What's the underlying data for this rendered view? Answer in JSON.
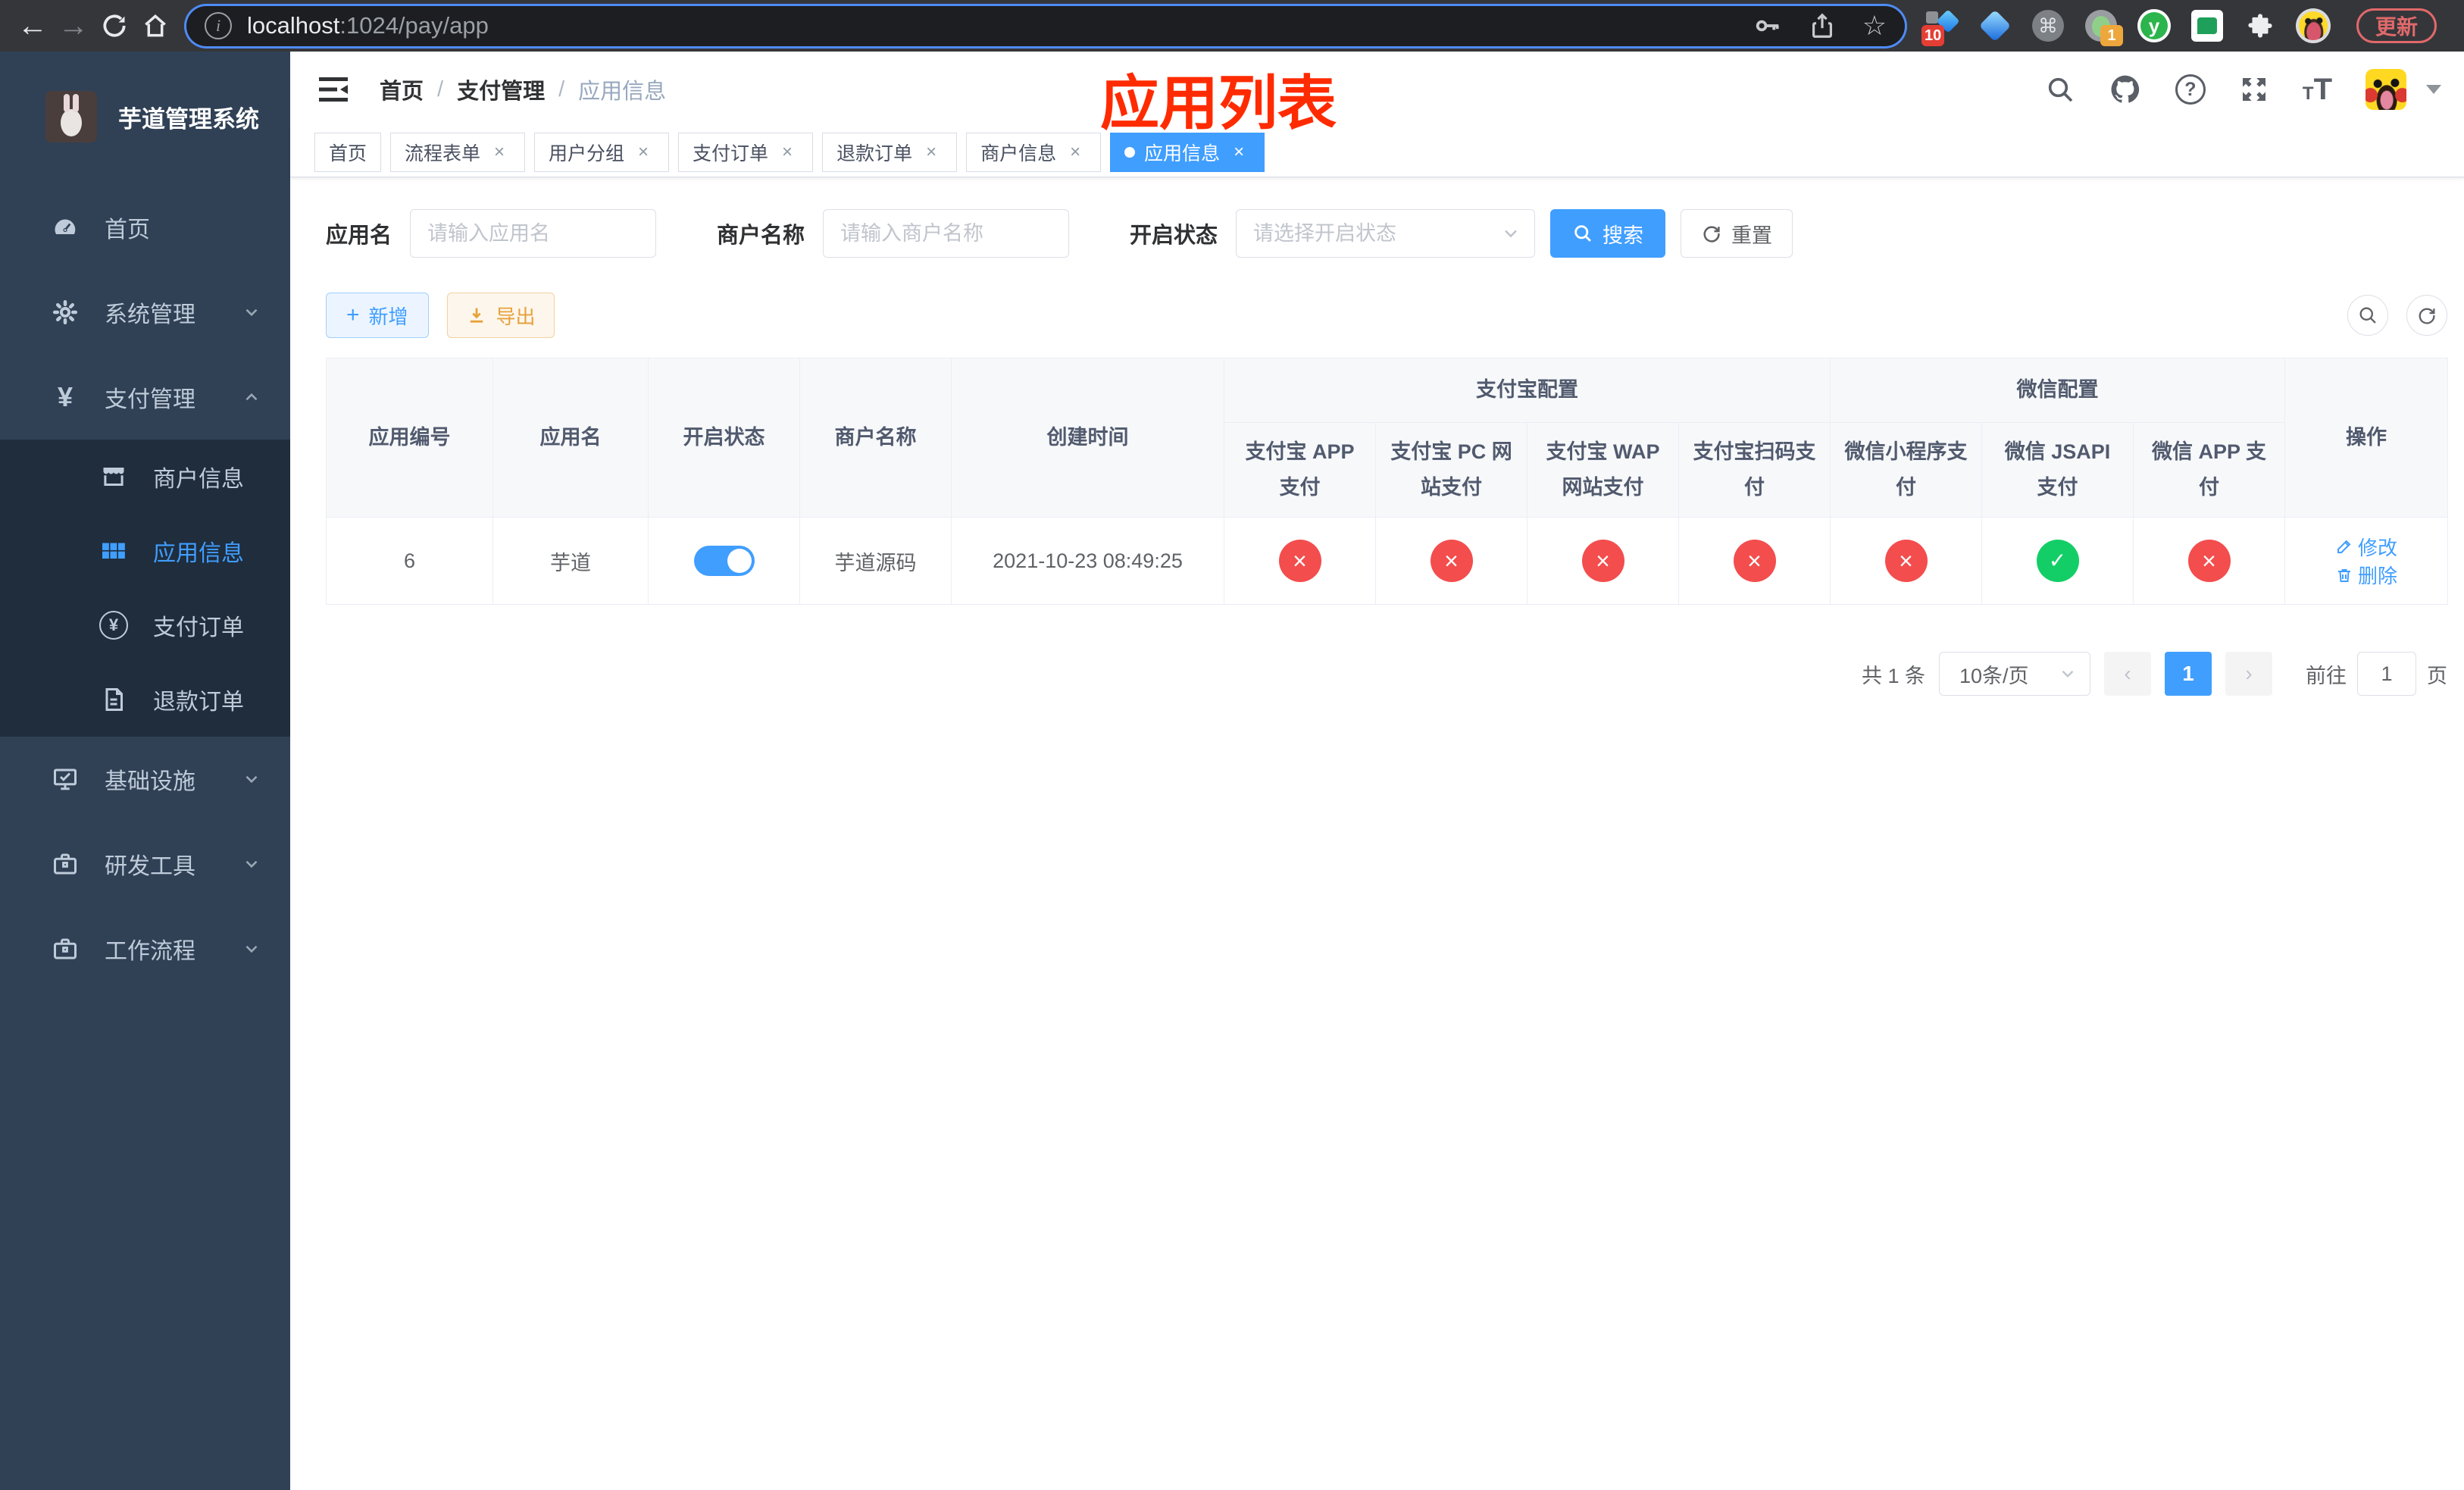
{
  "browser": {
    "url": {
      "host": "localhost",
      "path": ":1024/pay/app"
    },
    "update_button": "更新",
    "ext_badge_count_10": "10",
    "ext_badge_count_1": "1"
  },
  "annotation": {
    "text": "应用列表"
  },
  "sidebar": {
    "title": "芋道管理系统",
    "items": [
      {
        "label": "首页"
      },
      {
        "label": "系统管理"
      },
      {
        "label": "支付管理"
      },
      {
        "label": "商户信息"
      },
      {
        "label": "应用信息"
      },
      {
        "label": "支付订单"
      },
      {
        "label": "退款订单"
      },
      {
        "label": "基础设施"
      },
      {
        "label": "研发工具"
      },
      {
        "label": "工作流程"
      }
    ]
  },
  "navbar": {
    "breadcrumb": [
      "首页",
      "支付管理",
      "应用信息"
    ]
  },
  "tabs": [
    {
      "label": "首页"
    },
    {
      "label": "流程表单"
    },
    {
      "label": "用户分组"
    },
    {
      "label": "支付订单"
    },
    {
      "label": "退款订单"
    },
    {
      "label": "商户信息"
    },
    {
      "label": "应用信息"
    }
  ],
  "filters": {
    "app_name_label": "应用名",
    "app_name_placeholder": "请输入应用名",
    "merchant_label": "商户名称",
    "merchant_placeholder": "请输入商户名称",
    "status_label": "开启状态",
    "status_placeholder": "请选择开启状态",
    "search_button": "搜索",
    "reset_button": "重置"
  },
  "toolbar": {
    "add_button": "新增",
    "export_button": "导出"
  },
  "table": {
    "columns": [
      "应用编号",
      "应用名",
      "开启状态",
      "商户名称",
      "创建时间"
    ],
    "groups": {
      "alipay": "支付宝配置",
      "wechat": "微信配置"
    },
    "channel_columns": [
      "支付宝 APP 支付",
      "支付宝 PC 网站支付",
      "支付宝 WAP 网站支付",
      "支付宝扫码支付",
      "微信小程序支付",
      "微信 JSAPI 支付",
      "微信 APP 支付"
    ],
    "actions_column": "操作",
    "rows": [
      {
        "id": "6",
        "name": "芋道",
        "enabled": true,
        "merchant": "芋道源码",
        "created_at": "2021-10-23 08:49:25",
        "channels": [
          false,
          false,
          false,
          false,
          false,
          true,
          false
        ],
        "edit": "修改",
        "delete": "删除"
      }
    ]
  },
  "pagination": {
    "total": "共 1 条",
    "page_size": "10条/页",
    "page": "1",
    "goto_label": "前往",
    "goto_value": "1",
    "unit": "页"
  },
  "colors": {
    "primary": "#409eff",
    "success": "#13ce66",
    "danger": "#f34d4d",
    "warning": "#e6a23c",
    "annotation": "#ff2b00"
  }
}
